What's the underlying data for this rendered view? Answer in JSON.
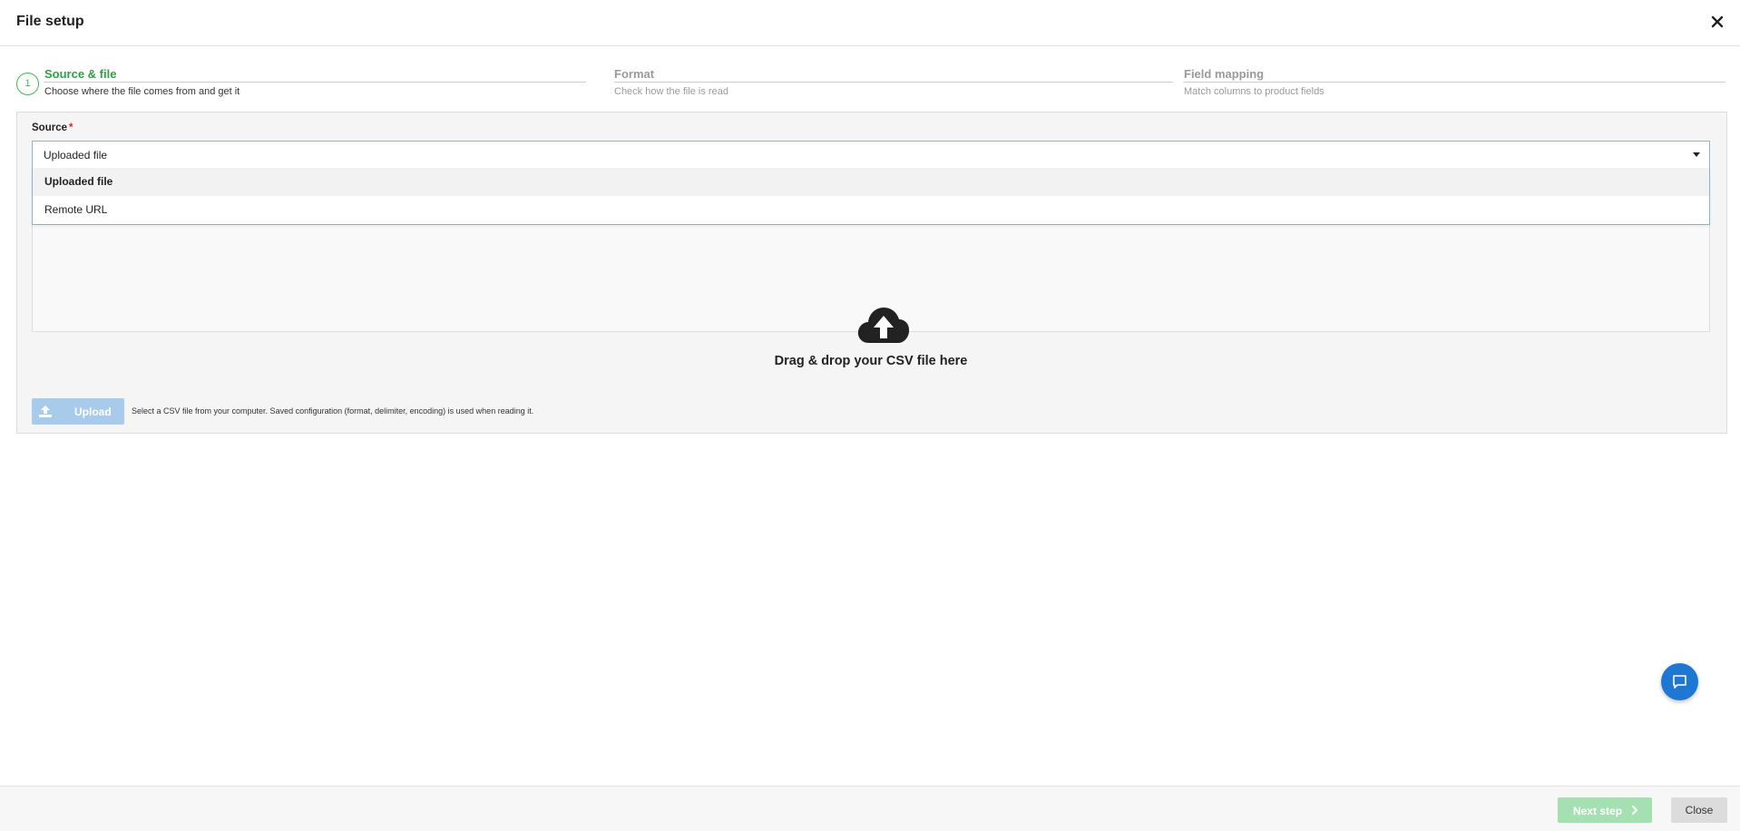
{
  "header": {
    "title": "File setup",
    "close_icon": "close-x-icon"
  },
  "steps": [
    {
      "number": "1",
      "label": "Source & file",
      "description": "Choose where the file comes from and get it",
      "state": "active"
    },
    {
      "label": "Format",
      "description": "Check how the file is read",
      "state": "inactive"
    },
    {
      "label": "Field mapping",
      "description": "Match columns to product fields",
      "state": "inactive"
    }
  ],
  "source": {
    "label": "Source",
    "required_mark": "*",
    "selected_value": "Uploaded file",
    "options": [
      "Uploaded file",
      "Remote URL"
    ]
  },
  "dropzone": {
    "icon": "cloud-upload-icon",
    "text": "Drag & drop your CSV file here"
  },
  "upload": {
    "button_label": "Upload",
    "help_text": "Select a CSV file from your computer. Saved configuration (format, delimiter, encoding) is used when reading it."
  },
  "footer": {
    "next_label": "Next step",
    "close_label": "Close"
  },
  "colors": {
    "accent_green": "#2ea043",
    "upload_disabled": "#a8cbec",
    "next_disabled": "#a5e0b2",
    "chat_blue": "#1f77d4"
  }
}
